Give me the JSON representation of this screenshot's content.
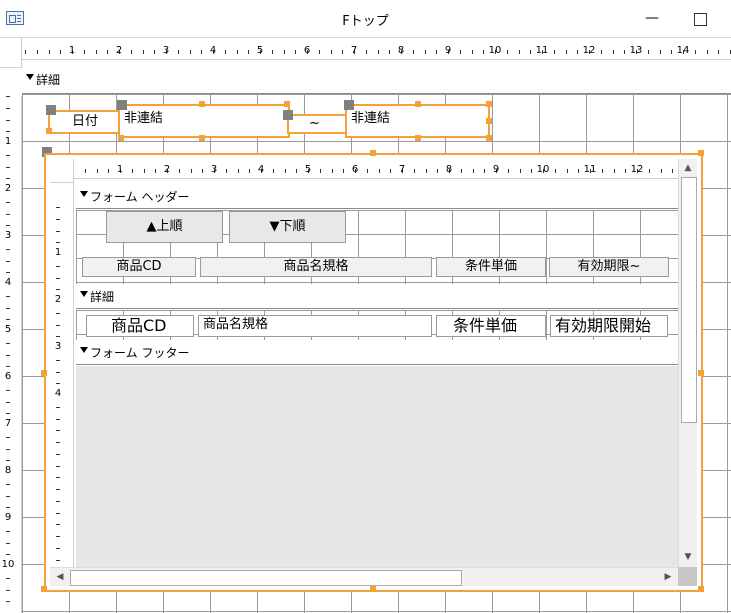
{
  "window": {
    "title": "Fトップ",
    "min_glyph": "—"
  },
  "ruler": {
    "numbers": [
      "1",
      "2",
      "3",
      "4",
      "5",
      "6",
      "7",
      "8",
      "9",
      "10",
      "11",
      "12",
      "13",
      "14"
    ],
    "left_numbers": [
      "1",
      "2",
      "3",
      "4",
      "5",
      "6",
      "7",
      "8",
      "9",
      "10"
    ]
  },
  "sections": {
    "detail": "詳細"
  },
  "main": {
    "date_label": "日付",
    "field1": "非連結",
    "tilde": "~",
    "field2": "非連結"
  },
  "subform": {
    "ruler_numbers": [
      "1",
      "2",
      "3",
      "4",
      "5",
      "6",
      "7",
      "8",
      "9",
      "10",
      "11",
      "12"
    ],
    "left_numbers": [
      "1",
      "2",
      "3",
      "4"
    ],
    "header_title": "フォーム ヘッダー",
    "buttons": {
      "asc": "▲上順",
      "desc": "▼下順"
    },
    "column_headers": [
      "商品CD",
      "商品名規格",
      "条件単価",
      "有効期限~"
    ],
    "detail_title": "詳細",
    "detail_fields": [
      "商品CD",
      "商品名規格",
      "条件単価",
      "有効期限開始"
    ],
    "footer_title": "フォーム フッター"
  },
  "colors": {
    "selection": "#f4a13a",
    "handle_gray": "#808080"
  }
}
